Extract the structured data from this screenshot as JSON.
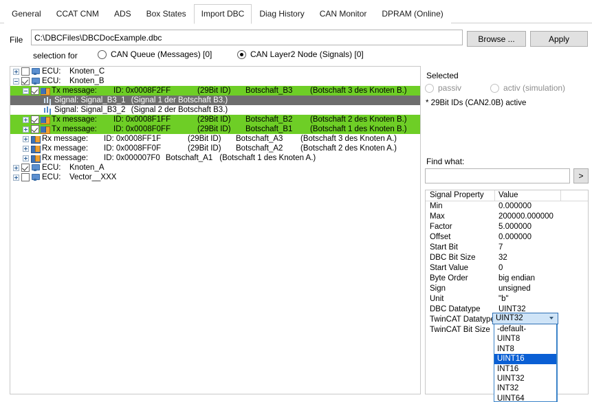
{
  "tabs": [
    {
      "label": "General",
      "active": false
    },
    {
      "label": "CCAT CNM",
      "active": false
    },
    {
      "label": "ADS",
      "active": false
    },
    {
      "label": "Box States",
      "active": false
    },
    {
      "label": "Import DBC",
      "active": true
    },
    {
      "label": "Diag History",
      "active": false
    },
    {
      "label": "CAN Monitor",
      "active": false
    },
    {
      "label": "DPRAM (Online)",
      "active": false
    }
  ],
  "file_row": {
    "label": "File",
    "value": "C:\\DBCFiles\\DBCDocExample.dbc",
    "placeholder": "",
    "browse_label": "Browse ...",
    "apply_label": "Apply"
  },
  "selection_for": {
    "label": "selection for",
    "options": [
      {
        "label": "CAN Queue (Messages) [0]",
        "checked": false
      },
      {
        "label": "CAN Layer2 Node (Signals) [0]",
        "checked": true
      }
    ]
  },
  "tree": [
    {
      "indent": 0,
      "expander": "plus",
      "checkbox": "unchecked",
      "icon": "ecu-icon",
      "kind": "ECU:",
      "name": "Knoten_C",
      "id": "",
      "bits": "",
      "desc": "",
      "state": "normal",
      "type": "ecu"
    },
    {
      "indent": 0,
      "expander": "minus",
      "checkbox": "checked",
      "icon": "ecu-icon",
      "kind": "ECU:",
      "name": "Knoten_B",
      "id": "",
      "bits": "",
      "desc": "",
      "state": "normal",
      "type": "ecu"
    },
    {
      "indent": 1,
      "expander": "minus",
      "checkbox": "checked",
      "icon": "tx-message-icon",
      "kind": "Tx message:",
      "id": "ID: 0x0008F2FF",
      "bits": "(29Bit ID)",
      "name": "Botschaft_B3",
      "desc": "(Botschaft 3 des Knoten B.)",
      "state": "green",
      "type": "msg"
    },
    {
      "indent": 2,
      "expander": "none",
      "checkbox": "none",
      "icon": "signal-icon",
      "kind": "Signal: Signal_B3_1",
      "id": "",
      "bits": "",
      "name": "",
      "desc": "(Signal 1 der Botschaft B3.)",
      "state": "selected",
      "type": "sig"
    },
    {
      "indent": 2,
      "expander": "none",
      "checkbox": "none",
      "icon": "signal-icon",
      "kind": "Signal: Signal_B3_2",
      "id": "",
      "bits": "",
      "name": "",
      "desc": "(Signal 2 der Botschaft B3.)",
      "state": "normal",
      "type": "sig"
    },
    {
      "indent": 1,
      "expander": "plus",
      "checkbox": "checked",
      "icon": "tx-message-icon",
      "kind": "Tx message:",
      "id": "ID: 0x0008F1FF",
      "bits": "(29Bit ID)",
      "name": "Botschaft_B2",
      "desc": "(Botschaft 2 des Knoten B.)",
      "state": "green",
      "type": "msg"
    },
    {
      "indent": 1,
      "expander": "plus",
      "checkbox": "checked",
      "icon": "tx-message-icon",
      "kind": "Tx message:",
      "id": "ID: 0x0008F0FF",
      "bits": "(29Bit ID)",
      "name": "Botschaft_B1",
      "desc": "(Botschaft 1 des Knoten B.)",
      "state": "green",
      "type": "msg"
    },
    {
      "indent": 1,
      "expander": "plus",
      "checkbox": "none",
      "icon": "rx-message-icon",
      "kind": "Rx message:",
      "id": "ID: 0x0008FF1F",
      "bits": "(29Bit ID)",
      "name": "Botschaft_A3",
      "desc": "(Botschaft 3 des Knoten A.)",
      "state": "normal",
      "type": "msg"
    },
    {
      "indent": 1,
      "expander": "plus",
      "checkbox": "none",
      "icon": "rx-message-icon",
      "kind": "Rx message:",
      "id": "ID: 0x0008FF0F",
      "bits": "(29Bit ID)",
      "name": "Botschaft_A2",
      "desc": "(Botschaft 2 des Knoten A.)",
      "state": "normal",
      "type": "msg"
    },
    {
      "indent": 1,
      "expander": "plus",
      "checkbox": "none",
      "icon": "rx-message-icon",
      "kind": "Rx message:",
      "id": "ID: 0x000007F0",
      "bits": "",
      "name": "Botschaft_A1",
      "desc": "(Botschaft 1 des Knoten A.)",
      "state": "normal",
      "type": "msg-short"
    },
    {
      "indent": 0,
      "expander": "plus",
      "checkbox": "checked",
      "icon": "ecu-icon",
      "kind": "ECU:",
      "name": "Knoten_A",
      "id": "",
      "bits": "",
      "desc": "",
      "state": "normal",
      "type": "ecu"
    },
    {
      "indent": 0,
      "expander": "plus",
      "checkbox": "unchecked",
      "icon": "ecu-icon",
      "kind": "ECU:",
      "name": "Vector__XXX",
      "id": "",
      "bits": "",
      "desc": "",
      "state": "normal",
      "type": "ecu"
    }
  ],
  "selected_panel": {
    "title": "Selected",
    "options": [
      {
        "label": "passiv",
        "checked": false
      },
      {
        "label": "activ (simulation)",
        "checked": false
      }
    ],
    "note": "* 29Bit IDs (CAN2.0B) active"
  },
  "find": {
    "label": "Find what:",
    "value": "",
    "placeholder": "",
    "button_label": ">"
  },
  "property_table": {
    "headers": [
      "Signal Property",
      "Value"
    ],
    "rows": [
      {
        "key": "Min",
        "value": "0.000000"
      },
      {
        "key": "Max",
        "value": "200000.000000"
      },
      {
        "key": "Factor",
        "value": "5.000000"
      },
      {
        "key": "Offset",
        "value": "0.000000"
      },
      {
        "key": "Start Bit",
        "value": "7"
      },
      {
        "key": "DBC Bit Size",
        "value": "32"
      },
      {
        "key": "Start Value",
        "value": "0"
      },
      {
        "key": "Byte Order",
        "value": "big endian"
      },
      {
        "key": "Sign",
        "value": "unsigned"
      },
      {
        "key": "Unit",
        "value": "\"b\""
      },
      {
        "key": "DBC Datatype",
        "value": "UINT32"
      },
      {
        "key": "TwinCAT Datatype",
        "value": ""
      },
      {
        "key": "TwinCAT Bit Size",
        "value": ""
      }
    ]
  },
  "datatype_combo": {
    "value": "UINT32",
    "open": true,
    "options": [
      {
        "label": "-default-",
        "highlighted": false
      },
      {
        "label": "UINT8",
        "highlighted": false
      },
      {
        "label": "INT8",
        "highlighted": false
      },
      {
        "label": "UINT16",
        "highlighted": true
      },
      {
        "label": "INT16",
        "highlighted": false
      },
      {
        "label": "UINT32",
        "highlighted": false
      },
      {
        "label": "INT32",
        "highlighted": false
      },
      {
        "label": "UINT64",
        "highlighted": false
      }
    ]
  },
  "colors": {
    "row_green": "#6ECE26",
    "row_selected": "#6E6E6E",
    "dropdown_highlight": "#0A5FD4",
    "combo_fill": "#CFE4F7",
    "combo_border": "#2D6FB5"
  }
}
